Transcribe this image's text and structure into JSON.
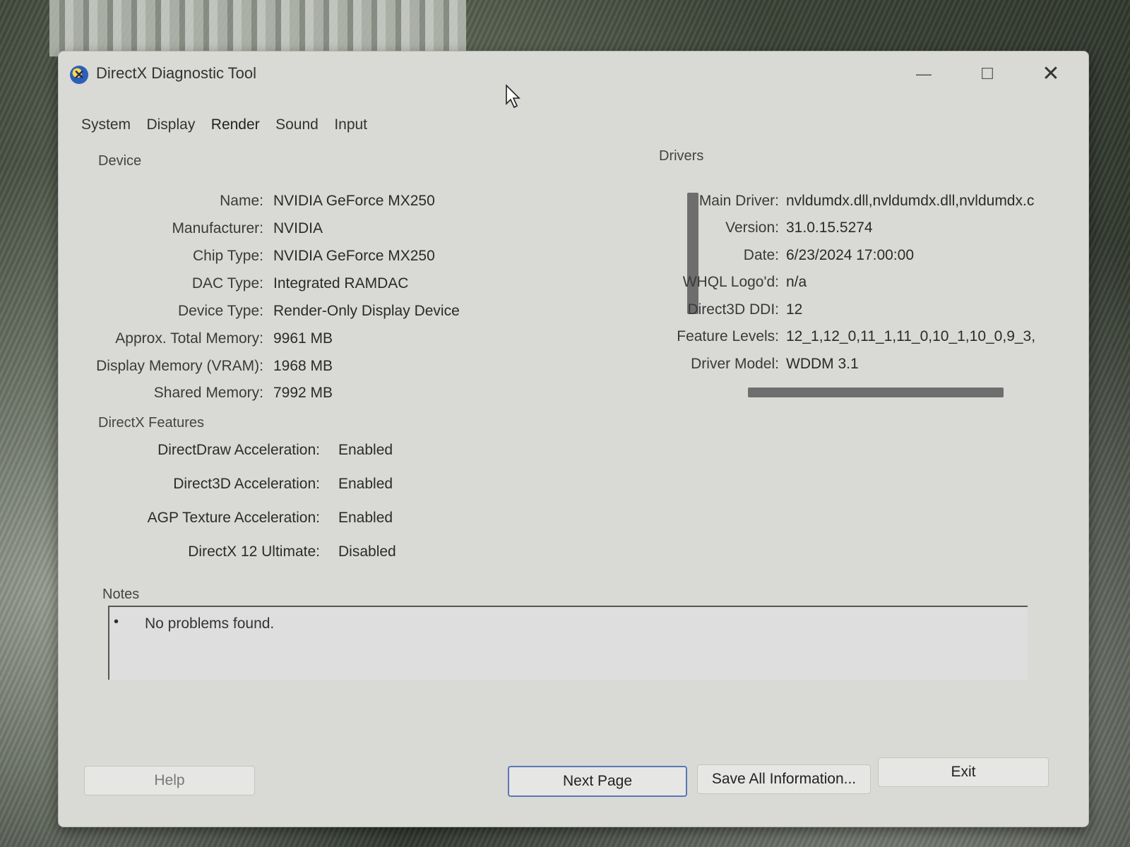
{
  "window": {
    "title": "DirectX Diagnostic Tool",
    "controls": {
      "minimize": "—",
      "maximize": "☐",
      "close": "✕"
    }
  },
  "tabs": [
    {
      "label": "System"
    },
    {
      "label": "Display"
    },
    {
      "label": "Render"
    },
    {
      "label": "Sound"
    },
    {
      "label": "Input"
    }
  ],
  "active_tab": "Render",
  "device": {
    "title": "Device",
    "fields": [
      {
        "label": "Name:",
        "value": "NVIDIA GeForce MX250"
      },
      {
        "label": "Manufacturer:",
        "value": "NVIDIA"
      },
      {
        "label": "Chip Type:",
        "value": "NVIDIA GeForce MX250"
      },
      {
        "label": "DAC Type:",
        "value": "Integrated RAMDAC"
      },
      {
        "label": "Device Type:",
        "value": "Render-Only Display Device"
      },
      {
        "label": "Approx. Total Memory:",
        "value": "9961 MB"
      },
      {
        "label": "Display Memory (VRAM):",
        "value": "1968 MB"
      },
      {
        "label": "Shared Memory:",
        "value": "7992 MB"
      }
    ]
  },
  "drivers": {
    "title": "Drivers",
    "fields": [
      {
        "label": "Main Driver:",
        "value": "nvldumdx.dll,nvldumdx.dll,nvldumdx.c"
      },
      {
        "label": "Version:",
        "value": "31.0.15.5274"
      },
      {
        "label": "Date:",
        "value": "6/23/2024 17:00:00"
      },
      {
        "label": "WHQL Logo'd:",
        "value": "n/a"
      },
      {
        "label": "Direct3D DDI:",
        "value": "12"
      },
      {
        "label": "Feature Levels:",
        "value": "12_1,12_0,11_1,11_0,10_1,10_0,9_3,"
      },
      {
        "label": "Driver Model:",
        "value": "WDDM 3.1"
      }
    ]
  },
  "directx_features": {
    "title": "DirectX Features",
    "fields": [
      {
        "label": "DirectDraw Acceleration:",
        "value": "Enabled"
      },
      {
        "label": "Direct3D Acceleration:",
        "value": "Enabled"
      },
      {
        "label": "AGP Texture Acceleration:",
        "value": "Enabled"
      },
      {
        "label": "DirectX 12 Ultimate:",
        "value": "Disabled"
      }
    ]
  },
  "notes": {
    "title": "Notes",
    "bullet": "•",
    "items": [
      "No problems found."
    ]
  },
  "buttons": {
    "help": "Help",
    "next_page": "Next Page",
    "save_all": "Save All Information...",
    "exit": "Exit"
  }
}
